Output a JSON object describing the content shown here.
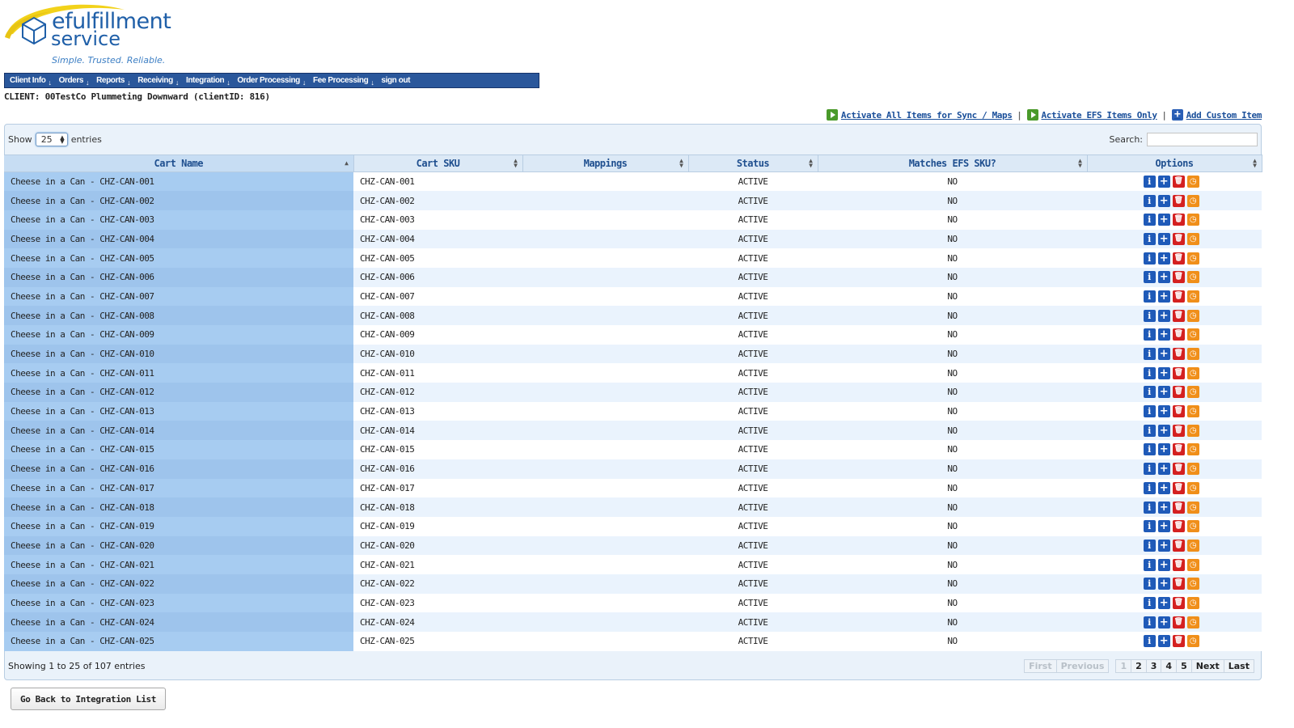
{
  "brand": {
    "name_line1": "efulfillment",
    "name_line2": "service",
    "tagline": "Simple. Trusted. Reliable."
  },
  "nav": [
    {
      "label": "Client Info",
      "arrow": "↓"
    },
    {
      "label": "Orders",
      "arrow": "↓"
    },
    {
      "label": "Reports",
      "arrow": "↓"
    },
    {
      "label": "Receiving",
      "arrow": "↓"
    },
    {
      "label": "Integration",
      "arrow": "↓"
    },
    {
      "label": "Order Processing",
      "arrow": "↓"
    },
    {
      "label": "Fee Processing",
      "arrow": "↓"
    },
    {
      "label": "sign out",
      "arrow": ""
    }
  ],
  "client_line": "CLIENT: 00TestCo Plummeting Downward (clientID: 816)",
  "actions": {
    "activate_all": "Activate All Items for Sync / Maps",
    "activate_efs": "Activate EFS Items Only",
    "add_custom": "Add Custom Item",
    "separator": "|"
  },
  "table_controls": {
    "show_label": "Show",
    "entries_label": "entries",
    "page_size": "25",
    "search_label": "Search:",
    "search_value": ""
  },
  "columns": [
    "Cart Name",
    "Cart SKU",
    "Mappings",
    "Status",
    "Matches EFS SKU?",
    "Options"
  ],
  "rows": [
    {
      "name": "Cheese in a Can - CHZ-CAN-001",
      "sku": "CHZ-CAN-001",
      "mappings": "",
      "status": "ACTIVE",
      "matches": "NO"
    },
    {
      "name": "Cheese in a Can - CHZ-CAN-002",
      "sku": "CHZ-CAN-002",
      "mappings": "",
      "status": "ACTIVE",
      "matches": "NO"
    },
    {
      "name": "Cheese in a Can - CHZ-CAN-003",
      "sku": "CHZ-CAN-003",
      "mappings": "",
      "status": "ACTIVE",
      "matches": "NO"
    },
    {
      "name": "Cheese in a Can - CHZ-CAN-004",
      "sku": "CHZ-CAN-004",
      "mappings": "",
      "status": "ACTIVE",
      "matches": "NO"
    },
    {
      "name": "Cheese in a Can - CHZ-CAN-005",
      "sku": "CHZ-CAN-005",
      "mappings": "",
      "status": "ACTIVE",
      "matches": "NO"
    },
    {
      "name": "Cheese in a Can - CHZ-CAN-006",
      "sku": "CHZ-CAN-006",
      "mappings": "",
      "status": "ACTIVE",
      "matches": "NO"
    },
    {
      "name": "Cheese in a Can - CHZ-CAN-007",
      "sku": "CHZ-CAN-007",
      "mappings": "",
      "status": "ACTIVE",
      "matches": "NO"
    },
    {
      "name": "Cheese in a Can - CHZ-CAN-008",
      "sku": "CHZ-CAN-008",
      "mappings": "",
      "status": "ACTIVE",
      "matches": "NO"
    },
    {
      "name": "Cheese in a Can - CHZ-CAN-009",
      "sku": "CHZ-CAN-009",
      "mappings": "",
      "status": "ACTIVE",
      "matches": "NO"
    },
    {
      "name": "Cheese in a Can - CHZ-CAN-010",
      "sku": "CHZ-CAN-010",
      "mappings": "",
      "status": "ACTIVE",
      "matches": "NO"
    },
    {
      "name": "Cheese in a Can - CHZ-CAN-011",
      "sku": "CHZ-CAN-011",
      "mappings": "",
      "status": "ACTIVE",
      "matches": "NO"
    },
    {
      "name": "Cheese in a Can - CHZ-CAN-012",
      "sku": "CHZ-CAN-012",
      "mappings": "",
      "status": "ACTIVE",
      "matches": "NO"
    },
    {
      "name": "Cheese in a Can - CHZ-CAN-013",
      "sku": "CHZ-CAN-013",
      "mappings": "",
      "status": "ACTIVE",
      "matches": "NO"
    },
    {
      "name": "Cheese in a Can - CHZ-CAN-014",
      "sku": "CHZ-CAN-014",
      "mappings": "",
      "status": "ACTIVE",
      "matches": "NO"
    },
    {
      "name": "Cheese in a Can - CHZ-CAN-015",
      "sku": "CHZ-CAN-015",
      "mappings": "",
      "status": "ACTIVE",
      "matches": "NO"
    },
    {
      "name": "Cheese in a Can - CHZ-CAN-016",
      "sku": "CHZ-CAN-016",
      "mappings": "",
      "status": "ACTIVE",
      "matches": "NO"
    },
    {
      "name": "Cheese in a Can - CHZ-CAN-017",
      "sku": "CHZ-CAN-017",
      "mappings": "",
      "status": "ACTIVE",
      "matches": "NO"
    },
    {
      "name": "Cheese in a Can - CHZ-CAN-018",
      "sku": "CHZ-CAN-018",
      "mappings": "",
      "status": "ACTIVE",
      "matches": "NO"
    },
    {
      "name": "Cheese in a Can - CHZ-CAN-019",
      "sku": "CHZ-CAN-019",
      "mappings": "",
      "status": "ACTIVE",
      "matches": "NO"
    },
    {
      "name": "Cheese in a Can - CHZ-CAN-020",
      "sku": "CHZ-CAN-020",
      "mappings": "",
      "status": "ACTIVE",
      "matches": "NO"
    },
    {
      "name": "Cheese in a Can - CHZ-CAN-021",
      "sku": "CHZ-CAN-021",
      "mappings": "",
      "status": "ACTIVE",
      "matches": "NO"
    },
    {
      "name": "Cheese in a Can - CHZ-CAN-022",
      "sku": "CHZ-CAN-022",
      "mappings": "",
      "status": "ACTIVE",
      "matches": "NO"
    },
    {
      "name": "Cheese in a Can - CHZ-CAN-023",
      "sku": "CHZ-CAN-023",
      "mappings": "",
      "status": "ACTIVE",
      "matches": "NO"
    },
    {
      "name": "Cheese in a Can - CHZ-CAN-024",
      "sku": "CHZ-CAN-024",
      "mappings": "",
      "status": "ACTIVE",
      "matches": "NO"
    },
    {
      "name": "Cheese in a Can - CHZ-CAN-025",
      "sku": "CHZ-CAN-025",
      "mappings": "",
      "status": "ACTIVE",
      "matches": "NO"
    }
  ],
  "row_options": [
    {
      "icon": "info-icon",
      "glyph": "i"
    },
    {
      "icon": "add-icon",
      "glyph": "+"
    },
    {
      "icon": "trash-icon",
      "glyph": "🗑"
    },
    {
      "icon": "clock-icon",
      "glyph": "◷"
    }
  ],
  "footer": {
    "showing": "Showing 1 to 25 of 107 entries",
    "pager": [
      {
        "label": "First",
        "state": "disabled"
      },
      {
        "label": "Previous",
        "state": "disabled"
      },
      {
        "label": "1",
        "state": "current"
      },
      {
        "label": "2",
        "state": "normal"
      },
      {
        "label": "3",
        "state": "normal"
      },
      {
        "label": "4",
        "state": "normal"
      },
      {
        "label": "5",
        "state": "normal"
      },
      {
        "label": "Next",
        "state": "normal"
      },
      {
        "label": "Last",
        "state": "normal"
      }
    ]
  },
  "back_button": "Go Back to Integration List",
  "colors": {
    "nav_bg": "#2a579b",
    "link": "#1a4f9a",
    "sorted_column": "#a7ccf1",
    "icon_blue": "#1f5ab8",
    "icon_red": "#d42020",
    "icon_orange": "#f08f1a",
    "icon_green": "#4a9a2a"
  }
}
